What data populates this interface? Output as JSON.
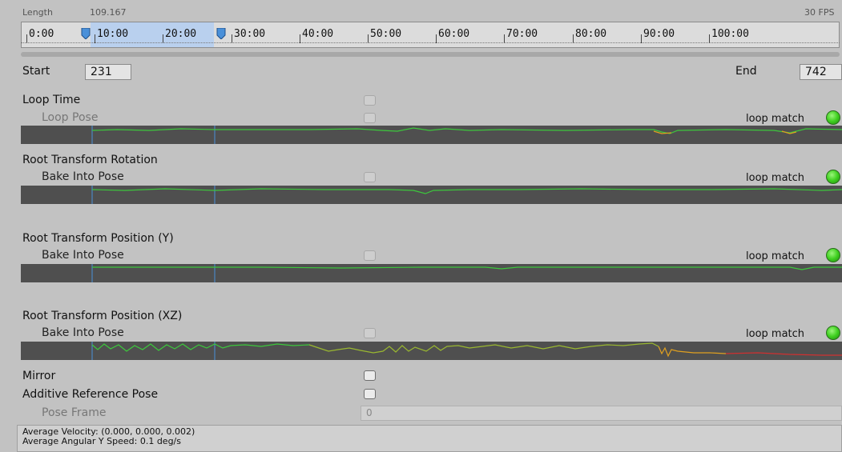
{
  "timeline": {
    "length_label": "Length",
    "length_value": "109.167",
    "fps": "30 FPS",
    "ticks": [
      "0:00",
      "10:00",
      "20:00",
      "30:00",
      "40:00",
      "50:00",
      "60:00",
      "70:00",
      "80:00",
      "90:00",
      "100:00"
    ]
  },
  "range": {
    "start_label": "Start",
    "start_value": "231",
    "end_label": "End",
    "end_value": "742"
  },
  "loop_time": {
    "label": "Loop Time",
    "loop_pose_label": "Loop Pose",
    "loop_match": "loop match",
    "loop_time_checked": false,
    "loop_pose_checked": false
  },
  "root_rotation": {
    "label": "Root Transform Rotation",
    "bake_label": "Bake Into Pose",
    "loop_match": "loop match",
    "bake_checked": false
  },
  "root_position_y": {
    "label": "Root Transform Position (Y)",
    "bake_label": "Bake Into Pose",
    "loop_match": "loop match",
    "bake_checked": false
  },
  "root_position_xz": {
    "label": "Root Transform Position (XZ)",
    "bake_label": "Bake Into Pose",
    "loop_match": "loop match",
    "bake_checked": false
  },
  "mirror": {
    "label": "Mirror",
    "checked": false
  },
  "additive": {
    "label": "Additive Reference Pose",
    "checked": false
  },
  "pose_frame": {
    "label": "Pose Frame",
    "value": "0"
  },
  "stats": {
    "velocity": "Average Velocity: (0.000, 0.000, 0.002)",
    "angular": "Average Angular Y Speed: 0.1 deg/s"
  },
  "colors": {
    "curve_green": "#3cc83c",
    "curve_orange": "#e0a020",
    "curve_red": "#d03030",
    "selection": "#b9d0ee",
    "marker_blue": "#4a90d9",
    "match_indicator": "#3fd020"
  },
  "icons": [
    "start-marker-icon",
    "end-marker-icon",
    "loop-match-indicator-icon"
  ]
}
